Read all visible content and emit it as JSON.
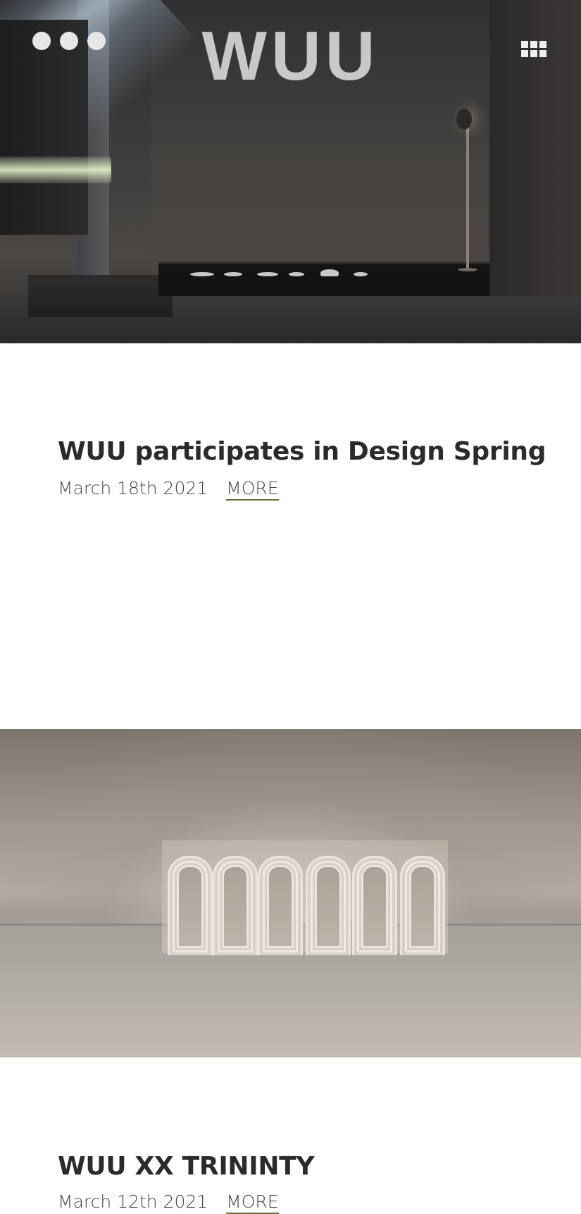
{
  "header": {
    "logo_text": "WUU",
    "menu_icon": "more-dots-icon",
    "grid_icon": "grid-icon"
  },
  "posts": [
    {
      "title": "WUU participates in Design Spring",
      "date": "March 18th 2021",
      "more_label": "MORE"
    },
    {
      "title": "WUU XX TRININTY",
      "date": "March 12th 2021",
      "more_label": "MORE"
    }
  ],
  "colors": {
    "text": "#2b2b2b",
    "meta": "#45454b",
    "underline": "#6f6a3c",
    "logo": "#c8c8c8"
  }
}
